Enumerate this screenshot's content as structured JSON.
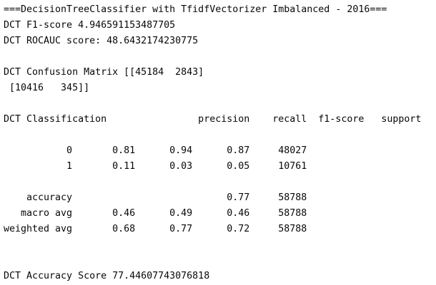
{
  "console": {
    "lines": [
      "===DecisionTreeClassifier with TfidfVectorizer Imbalanced - 2016===",
      "DCT F1-score 4.946591153487705",
      "DCT ROCAUC score: 48.6432174230775",
      "",
      "DCT Confusion Matrix [[45184  2843]",
      " [10416   345]]",
      "",
      "DCT Classification                precision    recall  f1-score   support",
      "",
      "           0       0.81      0.94      0.87     48027",
      "           1       0.11      0.03      0.05     10761",
      "",
      "    accuracy                           0.77     58788",
      "   macro avg       0.46      0.49      0.46     58788",
      "weighted avg       0.68      0.77      0.72     58788",
      "",
      "",
      "DCT Accuracy Score 77.44607743076818"
    ]
  }
}
